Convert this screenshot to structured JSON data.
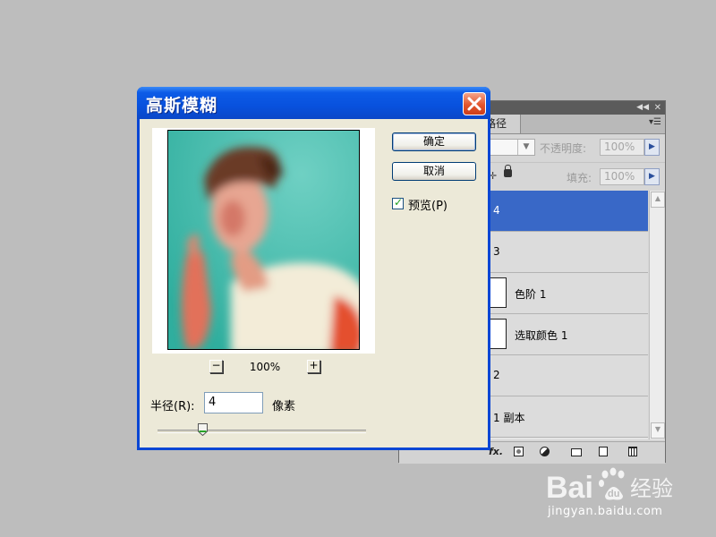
{
  "dialog": {
    "title": "高斯模糊",
    "ok_label": "确定",
    "cancel_label": "取消",
    "preview_label": "预览(P)",
    "preview_checked": true,
    "zoom_out_label": "−",
    "zoom_in_label": "+",
    "zoom_level": "100%",
    "radius_label": "半径(R):",
    "radius_value": "4",
    "radius_unit": "像素",
    "slider_fraction": 0.2
  },
  "layers_panel": {
    "tab_label": "路径",
    "opacity_label": "不透明度:",
    "opacity_value": "100%",
    "fill_label": "填充:",
    "fill_value": "100%",
    "layers": [
      {
        "name": "4",
        "selected": true,
        "adjustment": false
      },
      {
        "name": "3",
        "selected": false,
        "adjustment": false
      },
      {
        "name": "色阶 1",
        "selected": false,
        "adjustment": true
      },
      {
        "name": "选取颜色 1",
        "selected": false,
        "adjustment": true
      },
      {
        "name": "2",
        "selected": false,
        "adjustment": false
      },
      {
        "name": "1 副本",
        "selected": false,
        "adjustment": false
      }
    ]
  },
  "watermark": {
    "brand": "Baidu",
    "service": "经验",
    "url": "jingyan.baidu.com"
  },
  "colors": {
    "titlebar": "#0a51dd",
    "selected_layer": "#3968c7",
    "preview_bg": "#4ec0b2",
    "desktop": "#bdbdbd"
  }
}
